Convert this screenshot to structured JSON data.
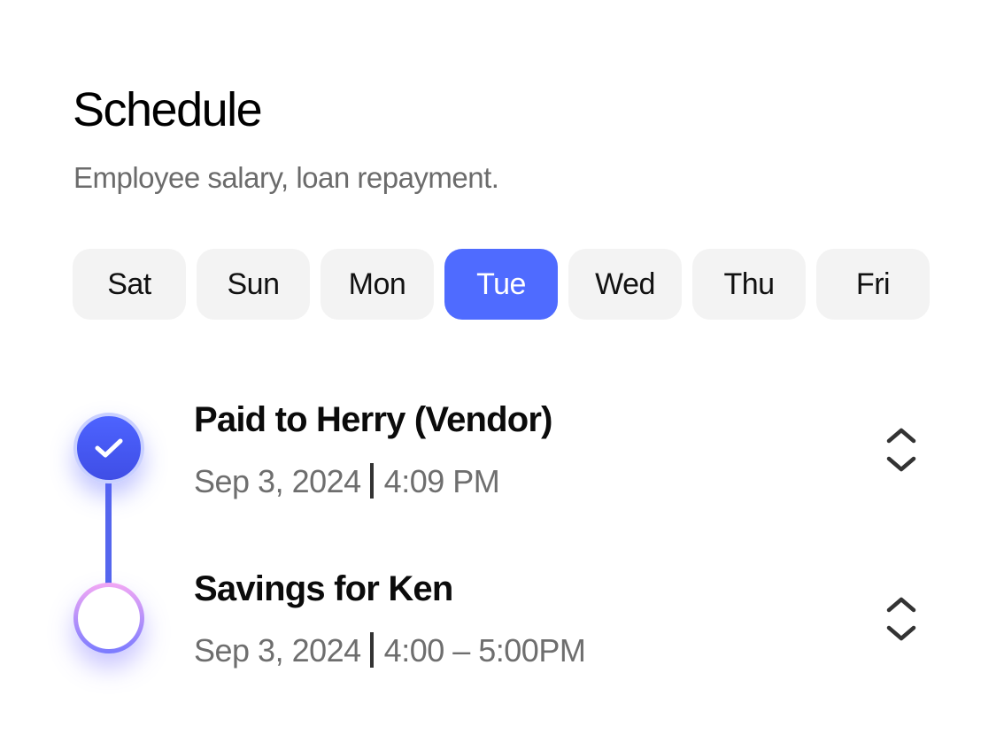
{
  "header": {
    "title": "Schedule",
    "subtitle": "Employee salary, loan repayment."
  },
  "days": [
    {
      "label": "Sat",
      "active": false
    },
    {
      "label": "Sun",
      "active": false
    },
    {
      "label": "Mon",
      "active": false
    },
    {
      "label": "Tue",
      "active": true
    },
    {
      "label": "Wed",
      "active": false
    },
    {
      "label": "Thu",
      "active": false
    },
    {
      "label": "Fri",
      "active": false
    }
  ],
  "colors": {
    "accent": "#4f6bff",
    "chip_bg": "#f3f3f3",
    "muted_text": "#6e6e6e"
  },
  "items": [
    {
      "title": "Paid to Herry (Vendor)",
      "date": "Sep 3, 2024",
      "time": "4:09 PM",
      "status": "completed",
      "status_icon": "check-icon",
      "action_icon": "sort-icon"
    },
    {
      "title": "Savings for Ken",
      "date": "Sep 3, 2024",
      "time": "4:00 – 5:00PM",
      "status": "pending",
      "status_icon": "empty-circle-icon",
      "action_icon": "sort-icon"
    }
  ]
}
